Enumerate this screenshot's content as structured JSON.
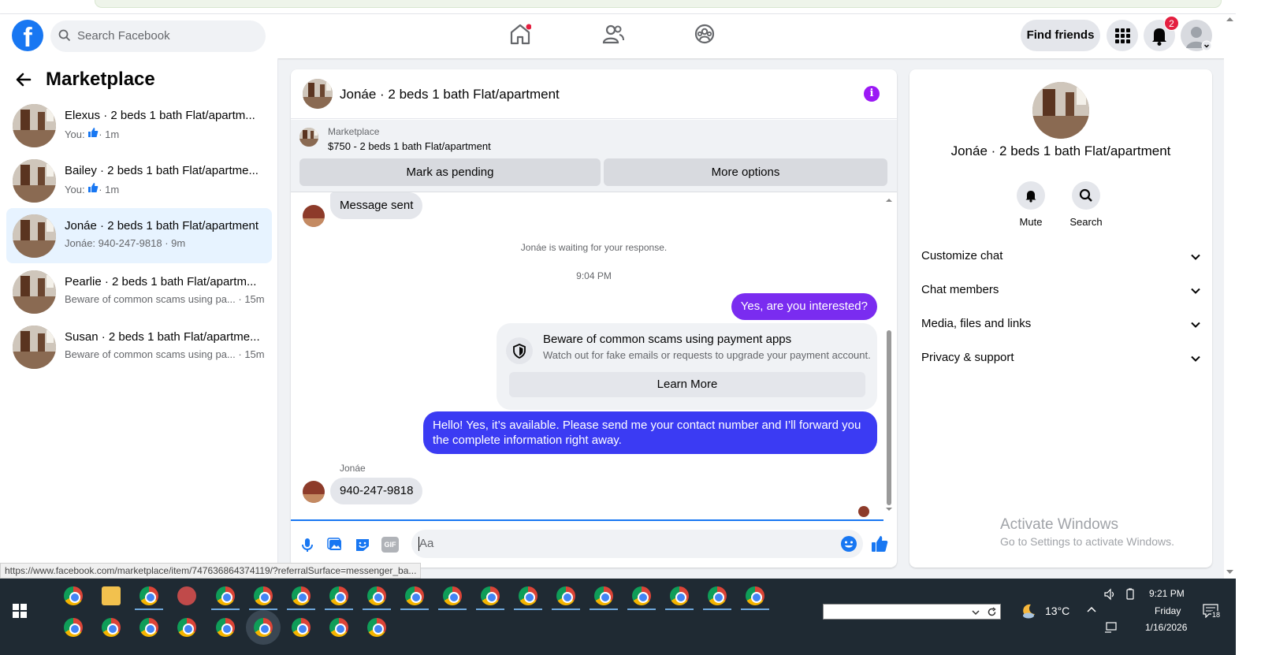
{
  "nav": {
    "search_placeholder": "Search Facebook",
    "find_friends": "Find friends",
    "notification_count": "2"
  },
  "sidebar": {
    "title": "Marketplace",
    "conversations": [
      {
        "name": "Elexus · 2 beds 1 bath Flat/apartm...",
        "sub_prefix": "You:",
        "sub_time": "· 1m",
        "icon": "thumbs-up-icon"
      },
      {
        "name": "Bailey · 2 beds 1 bath Flat/apartme...",
        "sub_prefix": "You:",
        "sub_time": "· 1m",
        "icon": "thumbs-up-icon"
      },
      {
        "name": "Jonáe · 2 beds 1 bath Flat/apartment",
        "sub": "Jonáe: 940-247-9818 · 9m"
      },
      {
        "name": "Pearlie · 2 beds 1 bath Flat/apartm...",
        "sub": "Beware of common scams using pa... · 15m"
      },
      {
        "name": "Susan · 2 beds 1 bath Flat/apartme...",
        "sub": "Beware of common scams using pa... · 15m"
      }
    ]
  },
  "chat": {
    "title": "Jonáe · 2 beds 1 bath Flat/apartment",
    "listing_source": "Marketplace",
    "listing_title": "$750 - 2 beds 1 bath Flat/apartment",
    "mark_pending": "Mark as pending",
    "more_options": "More options",
    "msg_sent": "Message sent",
    "waiting": "Jonáe is waiting for your response.",
    "time": "9:04 PM",
    "msg_interested": "Yes, are you interested?",
    "scam_title": "Beware of common scams using payment apps",
    "scam_body": "Watch out for fake emails or requests to upgrade your payment account.",
    "learn_more": "Learn More",
    "msg_hello": "Hello! Yes, it’s available. Please send me your contact number and I’ll forward you the complete information right away.",
    "sender": "Jonáe",
    "msg_phone": "940-247-9818",
    "composer_placeholder": "Aa",
    "gif": "GIF"
  },
  "rpanel": {
    "name": "Jonáe · 2 beds 1 bath Flat/apartment",
    "mute": "Mute",
    "search": "Search",
    "rows": [
      "Customize chat",
      "Chat members",
      "Media, files and links",
      "Privacy & support"
    ]
  },
  "watermark": {
    "line1": "Activate Windows",
    "line2": "Go to Settings to activate Windows."
  },
  "status_url": "https://www.facebook.com/marketplace/item/747636864374119/?referralSurface=messenger_ba...",
  "taskbar": {
    "weather": "13°C",
    "time": "9:21 PM",
    "day": "Friday",
    "date": "1/16/2026",
    "notif_count": "18"
  },
  "colors": {
    "brand": "#1877f2",
    "outgoing_bubble": "#3b3bf3",
    "purple_bubble": "#7a2cf0",
    "active_row": "#e7f3ff"
  }
}
